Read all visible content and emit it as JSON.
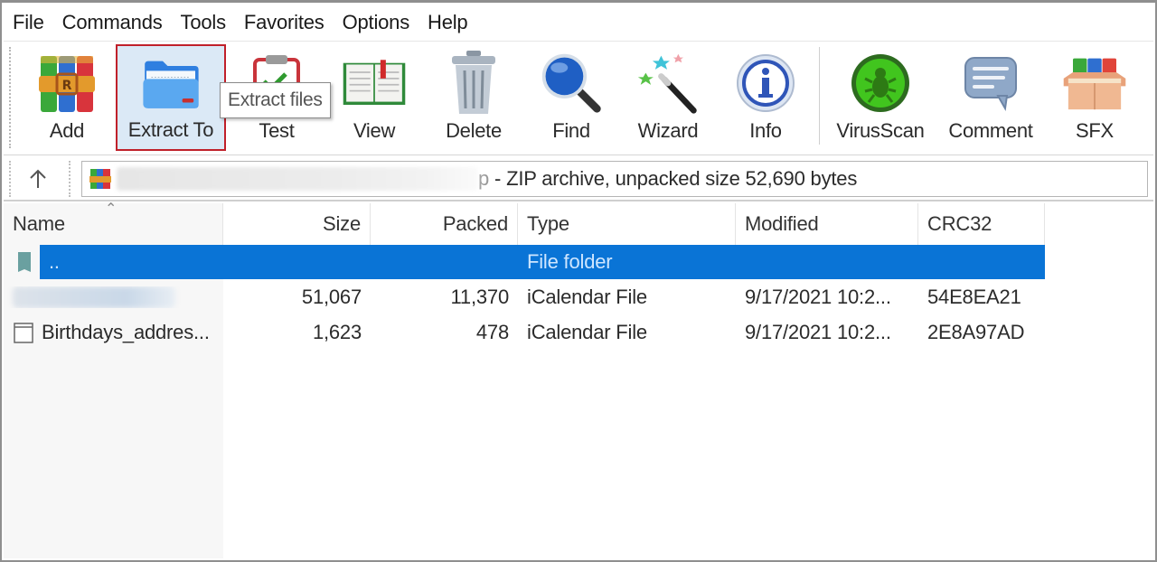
{
  "menu": [
    "File",
    "Commands",
    "Tools",
    "Favorites",
    "Options",
    "Help"
  ],
  "toolbar": {
    "buttons": [
      {
        "id": "add",
        "label": "Add",
        "icon": "add-archive-icon"
      },
      {
        "id": "extract",
        "label": "Extract To",
        "icon": "folder-extract-icon",
        "active": true
      },
      {
        "id": "test",
        "label": "Test",
        "icon": "clipboard-check-icon"
      },
      {
        "id": "view",
        "label": "View",
        "icon": "open-book-icon"
      },
      {
        "id": "delete",
        "label": "Delete",
        "icon": "trash-icon"
      },
      {
        "id": "find",
        "label": "Find",
        "icon": "magnifier-icon"
      },
      {
        "id": "wizard",
        "label": "Wizard",
        "icon": "magic-wand-icon"
      },
      {
        "id": "info",
        "label": "Info",
        "icon": "info-icon"
      },
      {
        "id": "virusscan",
        "label": "VirusScan",
        "icon": "bug-icon"
      },
      {
        "id": "comment",
        "label": "Comment",
        "icon": "speech-bubble-icon"
      },
      {
        "id": "sfx",
        "label": "SFX",
        "icon": "sfx-box-icon"
      }
    ],
    "tooltip": "Extract files",
    "highlight_color": "#c0202a"
  },
  "address": {
    "text": "- ZIP archive, unpacked size 52,690 bytes",
    "partial_prefix": "p"
  },
  "columns": [
    "Name",
    "Size",
    "Packed",
    "Type",
    "Modified",
    "CRC32"
  ],
  "rows": [
    {
      "name": "..",
      "size": "",
      "packed": "",
      "type": "File folder",
      "modified": "",
      "crc": "",
      "selected": true,
      "kind": "folder"
    },
    {
      "name": "",
      "size": "51,067",
      "packed": "11,370",
      "type": "iCalendar File",
      "modified": "9/17/2021 10:2...",
      "crc": "54E8EA21",
      "kind": "file-blurred"
    },
    {
      "name": "Birthdays_addres...",
      "size": "1,623",
      "packed": "478",
      "type": "iCalendar File",
      "modified": "9/17/2021 10:2...",
      "crc": "2E8A97AD",
      "kind": "file"
    }
  ],
  "colors": {
    "selection": "#0a74d6"
  }
}
